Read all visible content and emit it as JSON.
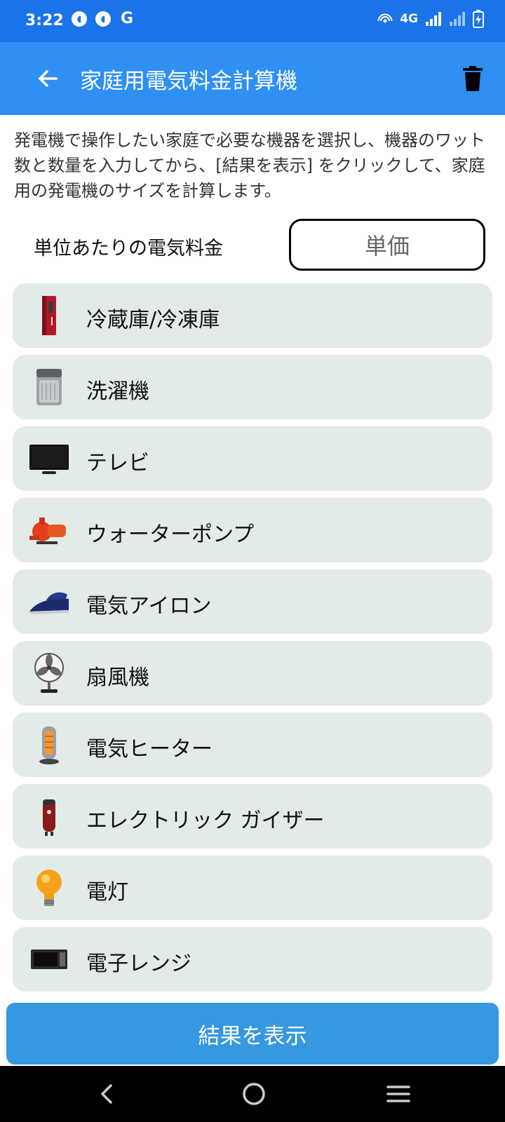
{
  "status_bar": {
    "time": "3:22",
    "network": "4G",
    "left_icons": [
      "app-notification-icon",
      "app-notification-icon",
      "google-icon"
    ],
    "right_icons": [
      "hotspot-icon",
      "signal-icon",
      "signal-icon",
      "battery-charging-icon"
    ],
    "colors": {
      "background": "#1a73e8"
    }
  },
  "app_bar": {
    "title": "家庭用電気料金計算機",
    "back_icon": "back-arrow-icon",
    "delete_icon": "trash-icon",
    "colors": {
      "background": "#2f8ff3"
    }
  },
  "description": "発電機で操作したい家庭で必要な機器を選択し、機器のワット数と数量を入力してから、[結果を表示] をクリックして、家庭用の発電機のサイズを計算します。",
  "unit_rate": {
    "label": "単位あたりの電気料金",
    "placeholder": "単価"
  },
  "appliances": [
    {
      "label": "冷蔵庫/冷凍庫",
      "icon": "refrigerator-icon"
    },
    {
      "label": "洗濯機",
      "icon": "washing-machine-icon"
    },
    {
      "label": "テレビ",
      "icon": "tv-icon"
    },
    {
      "label": "ウォーターポンプ",
      "icon": "water-pump-icon"
    },
    {
      "label": "電気アイロン",
      "icon": "iron-icon"
    },
    {
      "label": "扇風機",
      "icon": "fan-icon"
    },
    {
      "label": "電気ヒーター",
      "icon": "heater-icon"
    },
    {
      "label": "エレクトリック ガイザー",
      "icon": "geyser-icon"
    },
    {
      "label": "電灯",
      "icon": "light-bulb-icon"
    },
    {
      "label": "電子レンジ",
      "icon": "microwave-icon"
    }
  ],
  "show_result_button": {
    "label": "結果を表示",
    "colors": {
      "background": "#3698e0"
    }
  },
  "nav_bar": {
    "icons": [
      "nav-back-icon",
      "nav-home-icon",
      "nav-recents-icon"
    ]
  }
}
